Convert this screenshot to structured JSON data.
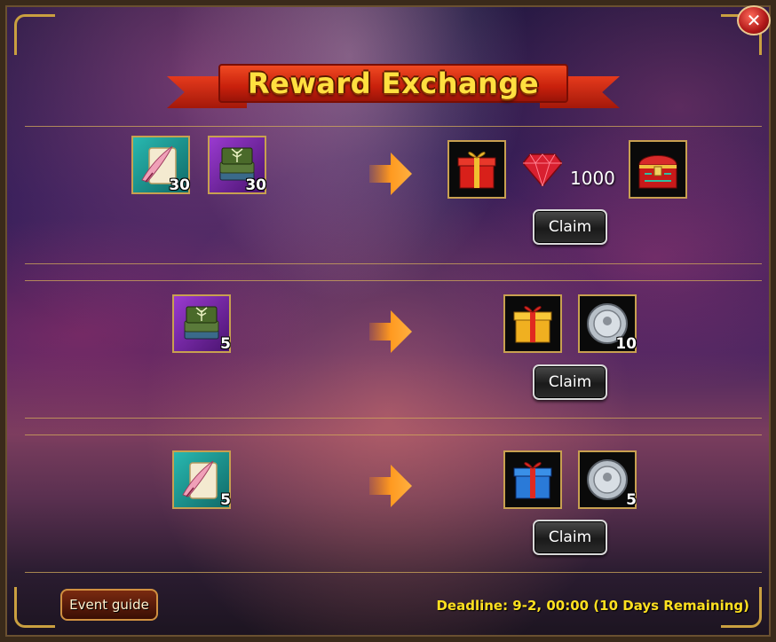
{
  "window": {
    "title": "Reward Exchange",
    "close_icon": "close-icon"
  },
  "rows": [
    {
      "inputs": [
        {
          "icon": "quill-scroll-icon",
          "count": "30"
        },
        {
          "icon": "tree-book-icon",
          "count": "30"
        }
      ],
      "outputs": [
        {
          "icon": "red-gift-box-icon",
          "count": ""
        },
        {
          "icon": "ruby-gem-icon",
          "count": "1000"
        },
        {
          "icon": "red-treasure-chest-icon",
          "count": ""
        }
      ],
      "claim_label": "Claim"
    },
    {
      "inputs": [
        {
          "icon": "tree-book-icon",
          "count": "5"
        }
      ],
      "outputs": [
        {
          "icon": "yellow-gift-box-icon",
          "count": ""
        },
        {
          "icon": "silver-coin-icon",
          "count": "10"
        }
      ],
      "claim_label": "Claim"
    },
    {
      "inputs": [
        {
          "icon": "quill-scroll-icon",
          "count": "5"
        }
      ],
      "outputs": [
        {
          "icon": "blue-gift-box-icon",
          "count": ""
        },
        {
          "icon": "silver-coin-icon",
          "count": "5"
        }
      ],
      "claim_label": "Claim"
    }
  ],
  "footer": {
    "event_guide_label": "Event guide",
    "deadline_text": "Deadline: 9-2, 00:00 (10 Days Remaining)"
  },
  "colors": {
    "title_text": "#ffe040",
    "banner": "#c8200c",
    "deadline_text": "#ffe020",
    "item_border": "#c8a050"
  }
}
